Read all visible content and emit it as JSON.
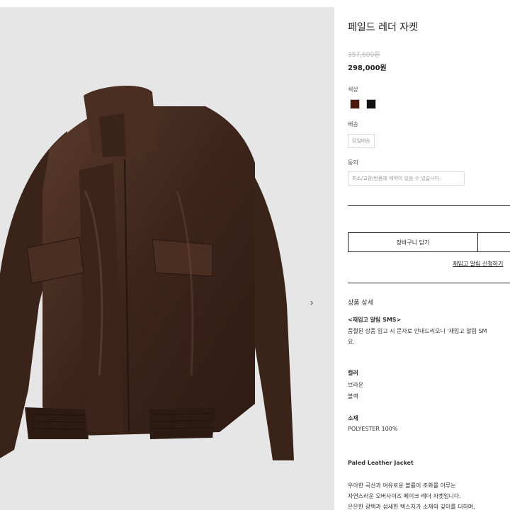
{
  "product": {
    "title": "페일드 레더 자켓",
    "original_price": "357,600원",
    "sale_price": "298,000원"
  },
  "options": {
    "color_label": "색상",
    "colors": [
      {
        "name": "브라운",
        "hex": "#4a1a0e"
      },
      {
        "name": "블랙",
        "hex": "#111111"
      }
    ],
    "shipping_label": "배송",
    "shipping_chip": "당일배송",
    "agree_label": "동의",
    "agree_text": "취소/교환/반품에 제약이 있음 수 있습니다."
  },
  "actions": {
    "cart": "장바구니 담기",
    "restock_link": "재입고 알림 신청하기"
  },
  "detail": {
    "heading": "상품 상세",
    "sms_title": "<재입고 알림 SMS>",
    "sms_line1": "품절된 상품 입고 시 문자로 안내드리오니 '재입고 알림 SM",
    "sms_line2": "요.",
    "color_title": "컬러",
    "color_1": "브라운",
    "color_2": "블랙",
    "material_title": "소재",
    "material_value": "POLYESTER 100%",
    "desc_title": "Paled Leather Jacket",
    "desc_1": "우아한 곡선과 여유로운 볼륨이 조화를 이루는",
    "desc_2": "자연스러운 오버사이즈 페이크 레더 자켓입니다.",
    "desc_3": "은은한 광택과 섬세한 텍스처가 소재의 깊이를 더하며,"
  },
  "gallery": {
    "next_icon": "›"
  }
}
